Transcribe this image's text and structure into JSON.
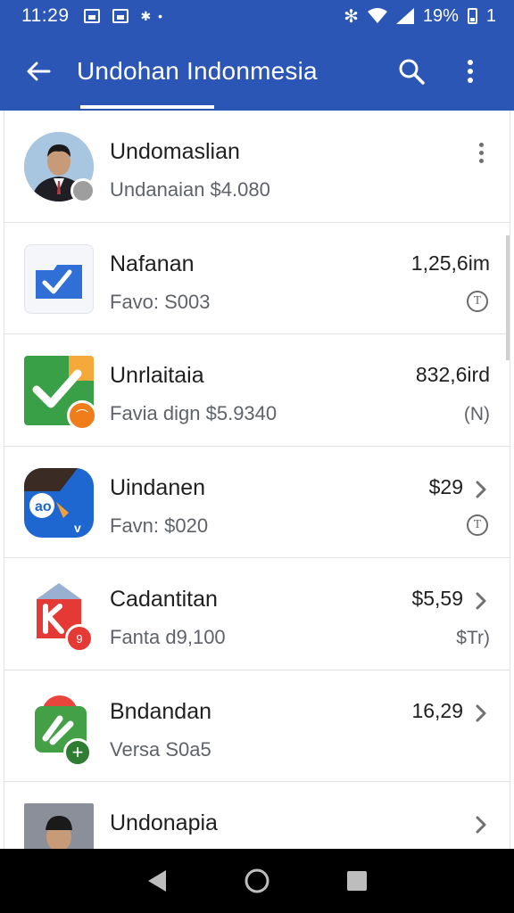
{
  "status_bar": {
    "time": "11:29",
    "battery_text": "19%",
    "extra": "1"
  },
  "app_bar": {
    "title": "Undohan Indonmesia",
    "icons": [
      "back-arrow-icon",
      "search-icon",
      "more-vert-icon"
    ]
  },
  "list": {
    "items": [
      {
        "name": "Undomaslian",
        "subtitle": "Undanaian $4.080",
        "value": "",
        "trailing": "kebab",
        "right_badge": "",
        "icon": "profile-photo",
        "accent": "#2b56b6"
      },
      {
        "name": "Nafanan",
        "subtitle": "Favo: S003",
        "value": "1,25,6im",
        "trailing": "info",
        "right_badge": "",
        "icon": "folder-check-icon",
        "accent": "#2f6fd6"
      },
      {
        "name": "Unrlaitaia",
        "subtitle": "Favia dign $5.9340",
        "value": "832,6ird",
        "trailing": "badge",
        "right_badge": "(N)",
        "icon": "green-check-icon",
        "accent": "#3aa047"
      },
      {
        "name": "Uindanen",
        "subtitle": "Favn: $020",
        "value": "$29",
        "trailing": "info",
        "right_badge": "",
        "icon": "blue-app-icon",
        "accent": "#1e66d0"
      },
      {
        "name": "Cadantitan",
        "subtitle": "Fanta d9,100",
        "value": "$5,59",
        "trailing": "badge",
        "right_badge": "$Tr)",
        "icon": "red-k-icon",
        "accent": "#e53935"
      },
      {
        "name": "Bndandan",
        "subtitle": "Versa S0a5",
        "value": "16,29",
        "trailing": "none",
        "right_badge": "",
        "icon": "green-plus-app-icon",
        "accent": "#43a047"
      },
      {
        "name": "Undonapia",
        "subtitle": "",
        "value": "",
        "trailing": "none",
        "right_badge": "",
        "icon": "profile-photo",
        "accent": "#607d8b"
      }
    ]
  },
  "nav_bar": {
    "icons": [
      "nav-back-icon",
      "nav-home-icon",
      "nav-recents-icon"
    ]
  }
}
